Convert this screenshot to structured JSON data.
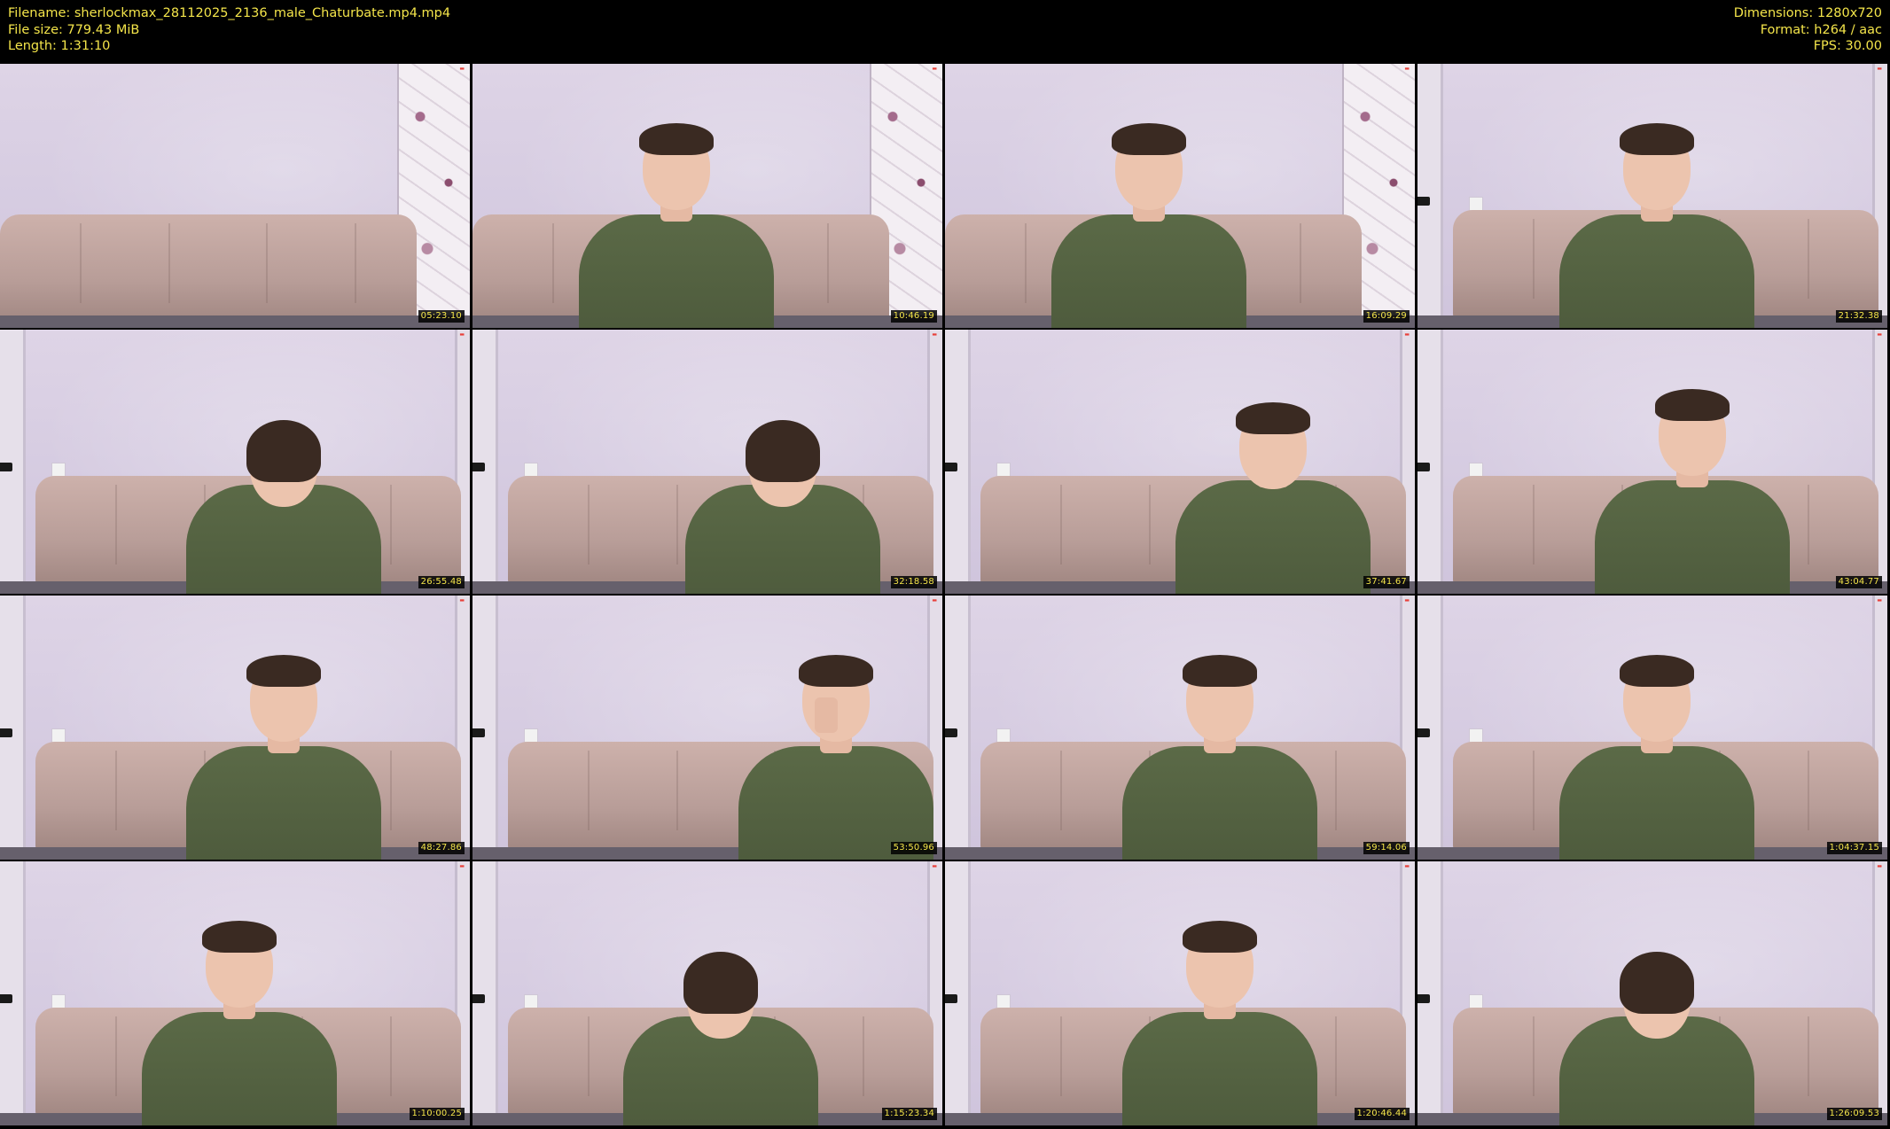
{
  "header": {
    "filename_label": "Filename: sherlockmax_28112025_2136_male_Chaturbate.mp4.mp4",
    "filesize_label": "File size: 779.43 MiB",
    "length_label": "Length: 1:31:10",
    "dimensions_label": "Dimensions: 1280x720",
    "format_label": "Format: h264 / aac",
    "fps_label": "FPS: 30.00"
  },
  "thumbnails": [
    {
      "timestamp": "05:23.10"
    },
    {
      "timestamp": "10:46.19"
    },
    {
      "timestamp": "16:09.29"
    },
    {
      "timestamp": "21:32.38"
    },
    {
      "timestamp": "26:55.48"
    },
    {
      "timestamp": "32:18.58"
    },
    {
      "timestamp": "37:41.67"
    },
    {
      "timestamp": "43:04.77"
    },
    {
      "timestamp": "48:27.86"
    },
    {
      "timestamp": "53:50.96"
    },
    {
      "timestamp": "59:14.06"
    },
    {
      "timestamp": "1:04:37.15"
    },
    {
      "timestamp": "1:10:00.25"
    },
    {
      "timestamp": "1:15:23.34"
    },
    {
      "timestamp": "1:20:46.44"
    },
    {
      "timestamp": "1:26:09.53"
    }
  ],
  "colors": {
    "metadata_text": "#f4e54a",
    "background": "#000000",
    "sweater": "#56643f",
    "sofa": "#c0a49f",
    "wall": "#d8cee2"
  }
}
